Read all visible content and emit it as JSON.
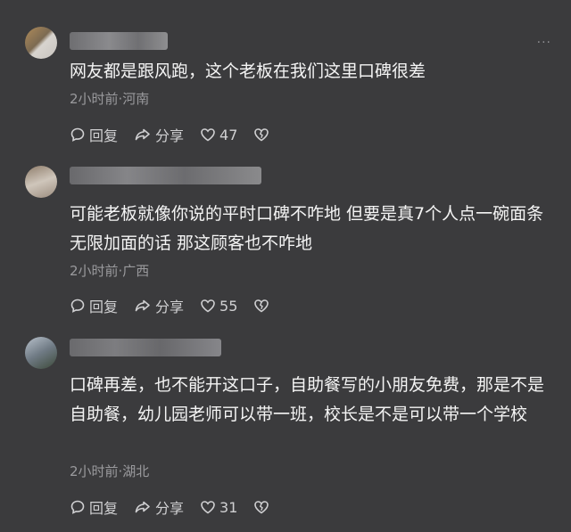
{
  "comments": [
    {
      "text": "网友都是跟风跑，这个老板在我们这里口碑很差",
      "meta": "2小时前·河南",
      "reply": "回复",
      "share": "分享",
      "likes": "47",
      "more": "···"
    },
    {
      "text": "可能老板就像你说的平时口碑不咋地 但要是真7个人点一碗面条 无限加面的话 那这顾客也不咋地",
      "meta": "2小时前·广西",
      "reply": "回复",
      "share": "分享",
      "likes": "55"
    },
    {
      "text": "口碑再差，也不能开这口子，自助餐写的小朋友免费，那是不是自助餐，幼儿园老师可以带一班，校长是不是可以带一个学校",
      "meta": "2小时前·湖北",
      "reply": "回复",
      "share": "分享",
      "likes": "31"
    }
  ]
}
